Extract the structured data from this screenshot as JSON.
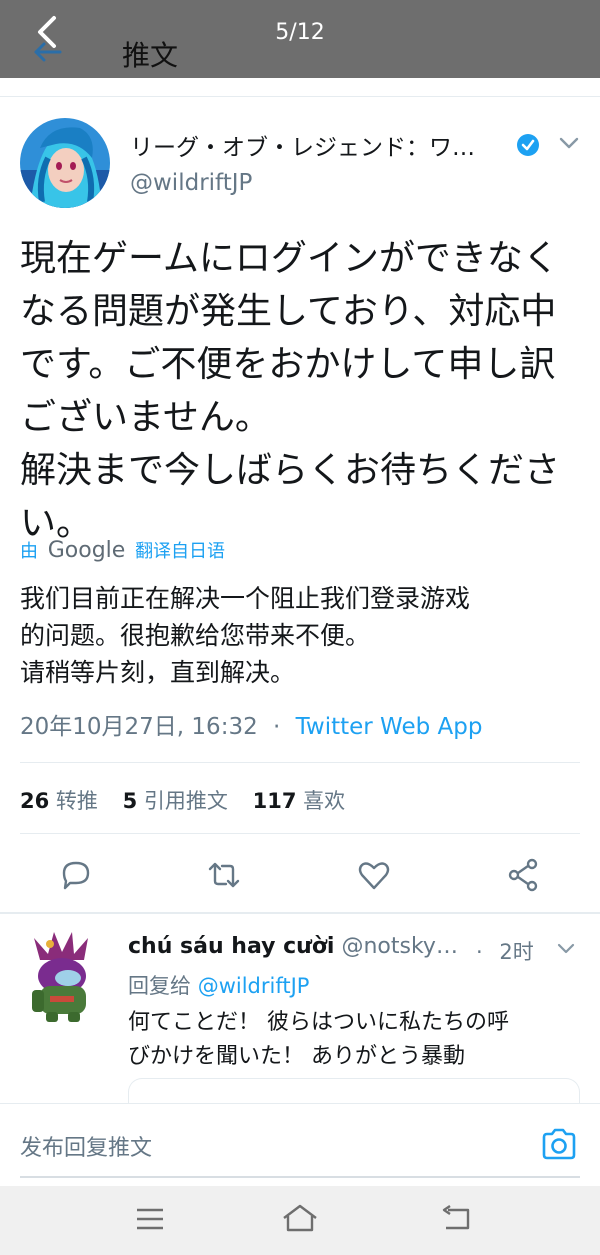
{
  "header": {
    "title": "推文",
    "counter": "5/12"
  },
  "tweet": {
    "display_name": "リーグ・オブ・レジェンド：ワ…",
    "handle": "@wildriftJP",
    "text_lines": [
      "現在ゲームにログインができなく",
      "なる問題が発生しており、対応中",
      "です。ご不便をおかけして申し訳",
      "ございません。",
      "解決まで今しばらくお待ちくださ",
      "い。"
    ],
    "translate": {
      "prefix": "由",
      "brand": "Google",
      "suffix": "翻译自日语"
    },
    "translated_lines": [
      "我们目前正在解决一个阻止我们登录游戏",
      "的问题。很抱歉给您带来不便。",
      "请稍等片刻，直到解决。"
    ],
    "timestamp": "20年10月27日, 16:32",
    "separator": "·",
    "source": "Twitter Web App",
    "stats": {
      "retweets_count": "26",
      "retweets_label": "转推",
      "quotes_count": "5",
      "quotes_label": "引用推文",
      "likes_count": "117",
      "likes_label": "喜欢"
    },
    "actions": [
      "reply-icon",
      "retweet-icon",
      "like-icon",
      "share-icon"
    ]
  },
  "reply": {
    "name": "chú sáu hay cười",
    "handle": "@notsky…",
    "separator": "·",
    "time": "2时",
    "reply_to_label": "回复给",
    "reply_to_handle": "@wildriftJP",
    "text_lines": [
      "何てことだ！ 彼らはついに私たちの呼",
      "びかけを聞いた！ ありがとう暴動"
    ]
  },
  "compose": {
    "placeholder": "发布回复推文",
    "icon": "camera-icon"
  },
  "system_nav": [
    "menu-icon",
    "home-icon",
    "back-icon"
  ],
  "colors": {
    "accent": "#1da1f2",
    "secondary_text": "#657786",
    "topbar": "#6e6e6e"
  }
}
